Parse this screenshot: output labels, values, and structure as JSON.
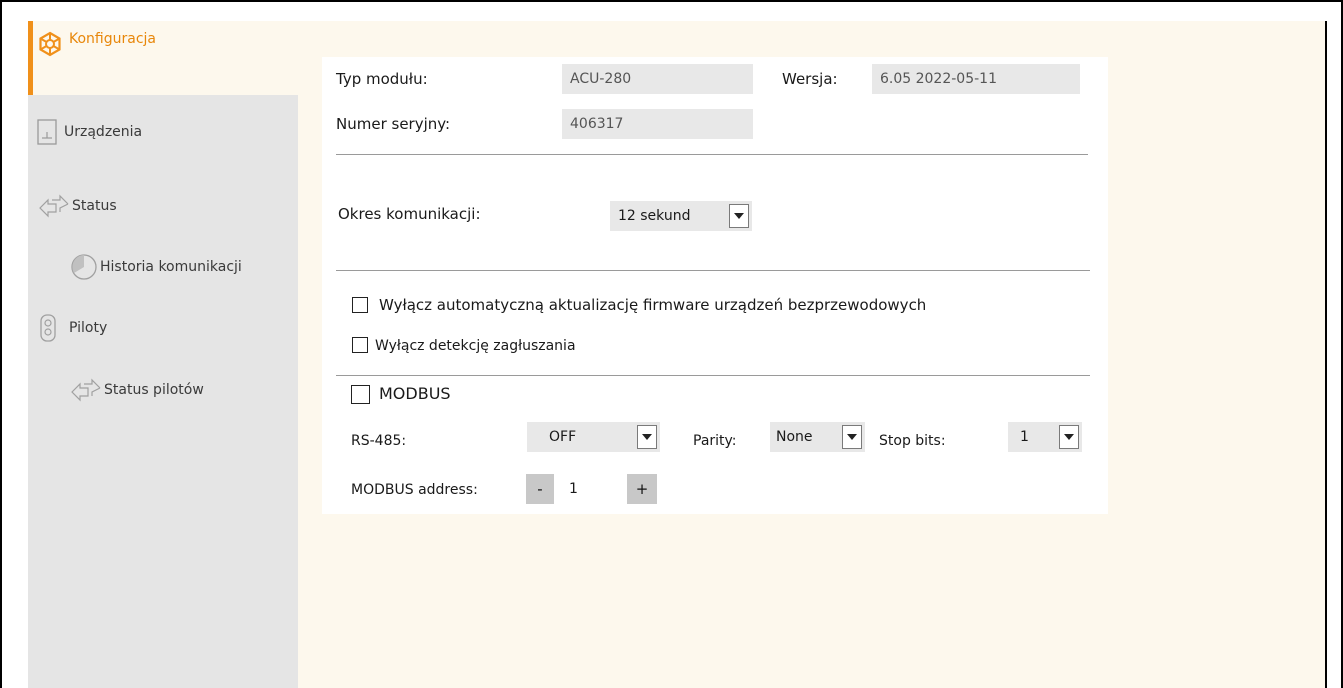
{
  "sidebar": {
    "items": [
      {
        "label": "Konfiguracja",
        "icon": "config-icon",
        "active": true
      },
      {
        "label": "Urządzenia",
        "icon": "device-icon"
      },
      {
        "label": "Status",
        "icon": "arrows-icon"
      },
      {
        "label": "Historia komunikacji",
        "icon": "history-icon"
      },
      {
        "label": "Piloty",
        "icon": "remote-icon"
      },
      {
        "label": "Status pilotów",
        "icon": "arrows-icon"
      }
    ]
  },
  "module": {
    "type_label": "Typ modułu:",
    "type_value": "ACU-280",
    "version_label": "Wersja:",
    "version_value": "6.05 2022-05-11",
    "serial_label": "Numer seryjny:",
    "serial_value": "406317"
  },
  "communication": {
    "period_label": "Okres komunikacji:",
    "period_value": "12 sekund"
  },
  "options": {
    "disable_fw_update": "Wyłącz automatyczną aktualizację firmware urządzeń bezprzewodowych",
    "disable_jamming": "Wyłącz detekcję zagłuszania"
  },
  "modbus": {
    "label": "MODBUS",
    "rs485_label": "RS-485:",
    "rs485_value": "OFF",
    "parity_label": "Parity:",
    "parity_value": "None",
    "stopbits_label": "Stop bits:",
    "stopbits_value": "1",
    "address_label": "MODBUS address:",
    "address_value": "1",
    "minus": "-",
    "plus": "+"
  },
  "colors": {
    "accent": "#f0901a",
    "sidebar_bg": "#e5e5e5",
    "content_bg": "#fdf8ed"
  }
}
